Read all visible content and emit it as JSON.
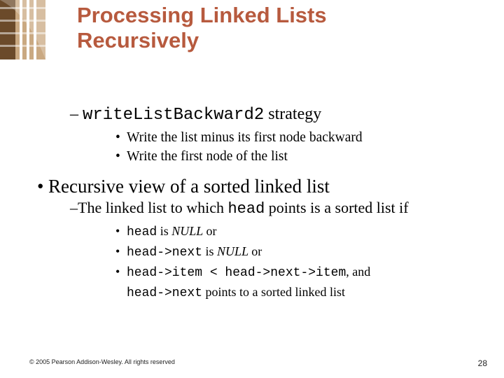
{
  "title_line1": "Processing Linked Lists",
  "title_line2": "Recursively",
  "strategy": {
    "code": "writeListBackward2",
    "after": " strategy",
    "steps": [
      "Write the list minus its first node backward",
      "Write the first node of the list"
    ]
  },
  "recursive_view": {
    "heading": "Recursive view of a sorted linked list",
    "sub": {
      "prefix": "The linked list to which ",
      "code": "head",
      "suffix": " points is a sorted list if"
    },
    "conds": {
      "c1": {
        "code": "head",
        "mid": " is ",
        "tail_italic": "NULL ",
        "tail": "or"
      },
      "c2": {
        "code": "head->next",
        "mid": " is ",
        "tail_italic": "NULL ",
        "tail": "or"
      },
      "c3": {
        "code": "head->item < head->next->item",
        "tail": ", and"
      },
      "c4": {
        "code": "head->next",
        "tail": " points to a sorted linked list"
      }
    }
  },
  "footer": {
    "copyright": "© 2005 Pearson Addison-Wesley. All rights reserved",
    "page": "28"
  },
  "deco_colors": {
    "dark": "#6b4a2a",
    "light": "#caa982",
    "white": "#ffffff"
  }
}
